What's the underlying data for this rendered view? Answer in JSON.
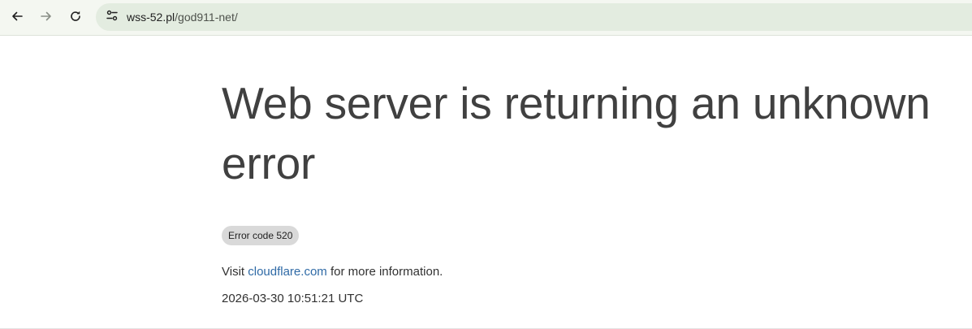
{
  "browser": {
    "url_host": "wss-52.pl",
    "url_path": "/god911-net/",
    "toolbar_color": "#f4f7f1",
    "omnibox_color": "#e3ece0",
    "icons": [
      "back-arrow-icon",
      "forward-arrow-icon",
      "reload-icon",
      "site-info-icon"
    ]
  },
  "page": {
    "headline": "Web server is returning an unknown error",
    "error_code": "Error code 520",
    "visit_prefix": "Visit ",
    "visit_link": "cloudflare.com",
    "visit_suffix": " for more information.",
    "timestamp": "2026-03-30 10:51:21 UTC",
    "link_color": "#2f6aa6"
  }
}
